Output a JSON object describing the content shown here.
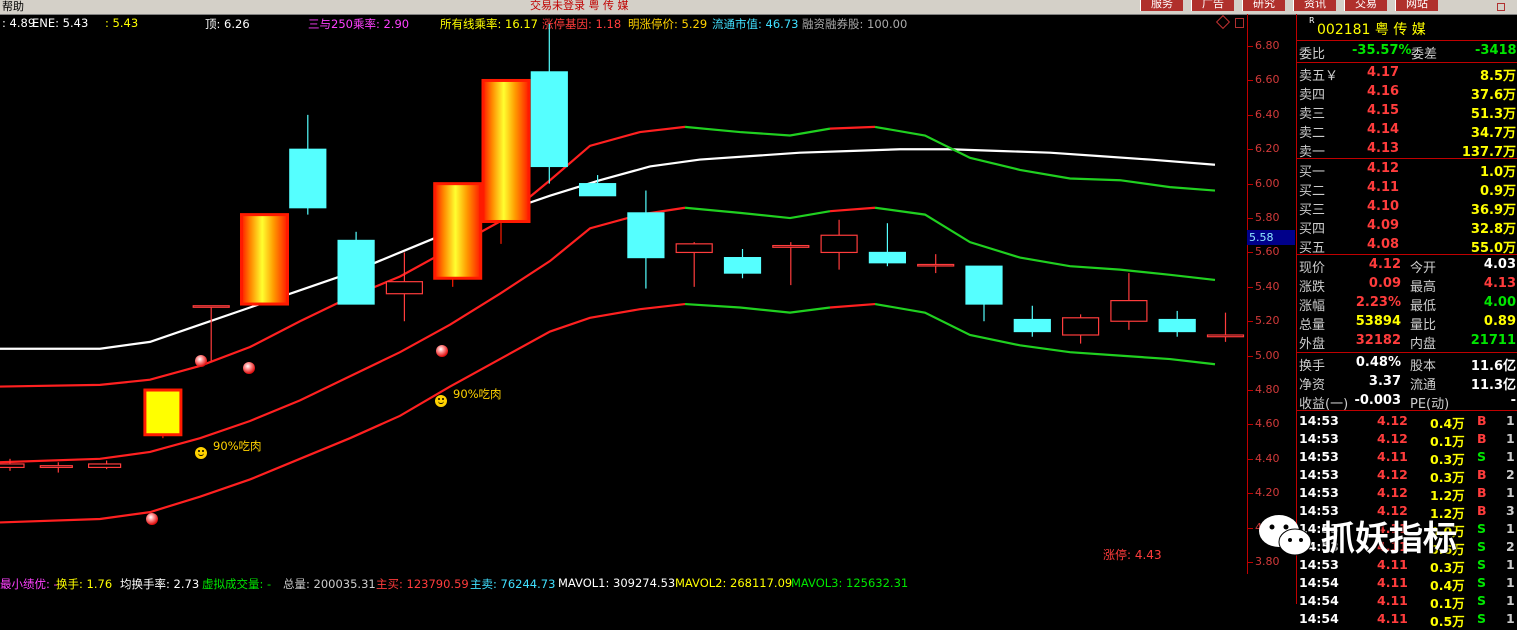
{
  "topbar": {
    "menu": "帮助",
    "window_title": "交易未登录  粤 传 媒",
    "buttons": [
      "服务",
      "广告",
      "研究",
      "资讯",
      "交易",
      "网站"
    ]
  },
  "indicator_line": [
    {
      "text": ": 4.89",
      "color": "#ffffff"
    },
    {
      "text": "ENE: 5.43",
      "color": "#ffffff"
    },
    {
      "text": ": 5.43",
      "color": "#ffff00"
    },
    {
      "text": "顶: 6.26",
      "color": "#ffffff"
    },
    {
      "text": "三与250乘率: 2.90",
      "color": "#ff40ff"
    },
    {
      "text": "所有线乘率: 16.17",
      "color": "#ffff00"
    },
    {
      "text": "涨停基因: 1.18",
      "color": "#ff3c3c"
    },
    {
      "text": "明涨停价: 5.29",
      "color": "#ffd200"
    },
    {
      "text": "流通市值: 46.73",
      "color": "#40e0ff"
    },
    {
      "text": "融资融券股: 100.00",
      "color": "#aaaaaa"
    }
  ],
  "chart_data": {
    "type": "candlestick",
    "ylim": [
      3.8,
      6.94
    ],
    "yticks": [
      "6.80",
      "6.60",
      "6.40",
      "6.20",
      "6.00",
      "5.80",
      "5.60",
      "5.40",
      "5.20",
      "5.00",
      "4.80",
      "4.60",
      "4.40",
      "4.20",
      "4.00",
      "3.80"
    ],
    "current_price_label": "5.58",
    "limit_up_label": "涨停: 4.43",
    "candles": [
      {
        "o": 4.37,
        "c": 4.35,
        "h": 4.4,
        "l": 4.33
      },
      {
        "o": 4.36,
        "c": 4.35,
        "h": 4.38,
        "l": 4.32
      },
      {
        "o": 4.37,
        "c": 4.35,
        "h": 4.39,
        "l": 4.34
      },
      {
        "o": 4.54,
        "c": 4.8,
        "h": 4.8,
        "l": 4.52,
        "style": "limit"
      },
      {
        "o": 5.29,
        "c": 5.29,
        "h": 5.29,
        "l": 4.97,
        "style": "doji"
      },
      {
        "o": 5.3,
        "c": 5.82,
        "h": 5.82,
        "l": 5.3,
        "style": "limit"
      },
      {
        "o": 5.86,
        "c": 6.2,
        "h": 6.4,
        "l": 5.82,
        "style": "down"
      },
      {
        "o": 5.67,
        "c": 5.3,
        "h": 5.72,
        "l": 5.3,
        "style": "down"
      },
      {
        "o": 5.36,
        "c": 5.43,
        "h": 5.6,
        "l": 5.2,
        "style": "up"
      },
      {
        "o": 5.45,
        "c": 6.0,
        "h": 6.0,
        "l": 5.4,
        "style": "limit"
      },
      {
        "o": 5.78,
        "c": 6.6,
        "h": 6.6,
        "l": 5.65,
        "style": "limit"
      },
      {
        "o": 6.65,
        "c": 6.1,
        "h": 6.93,
        "l": 6.0,
        "style": "down"
      },
      {
        "o": 6.0,
        "c": 5.93,
        "h": 6.05,
        "l": 5.93,
        "style": "down"
      },
      {
        "o": 5.83,
        "c": 5.57,
        "h": 5.96,
        "l": 5.39,
        "style": "down"
      },
      {
        "o": 5.65,
        "c": 5.6,
        "h": 5.66,
        "l": 5.4,
        "style": "up"
      },
      {
        "o": 5.57,
        "c": 5.48,
        "h": 5.62,
        "l": 5.45,
        "style": "down"
      },
      {
        "o": 5.64,
        "c": 5.63,
        "h": 5.66,
        "l": 5.41,
        "style": "up"
      },
      {
        "o": 5.6,
        "c": 5.7,
        "h": 5.79,
        "l": 5.5,
        "style": "up"
      },
      {
        "o": 5.6,
        "c": 5.54,
        "h": 5.77,
        "l": 5.52,
        "style": "down"
      },
      {
        "o": 5.53,
        "c": 5.53,
        "h": 5.59,
        "l": 5.48,
        "style": "up"
      },
      {
        "o": 5.52,
        "c": 5.3,
        "h": 5.52,
        "l": 5.2,
        "style": "down"
      },
      {
        "o": 5.21,
        "c": 5.14,
        "h": 5.29,
        "l": 5.11,
        "style": "down"
      },
      {
        "o": 5.12,
        "c": 5.22,
        "h": 5.24,
        "l": 5.07,
        "style": "up"
      },
      {
        "o": 5.2,
        "c": 5.32,
        "h": 5.48,
        "l": 5.15,
        "style": "up"
      },
      {
        "o": 5.21,
        "c": 5.14,
        "h": 5.26,
        "l": 5.11,
        "style": "down"
      },
      {
        "o": 5.11,
        "c": 5.12,
        "h": 5.25,
        "l": 5.08,
        "style": "up"
      }
    ]
  },
  "annotations": {
    "label_90": "90%吃肉"
  },
  "quote": {
    "r_badge": "R",
    "code": "002181",
    "name": "粤 传 媒",
    "wei_bi": {
      "label": "委比",
      "value": "-35.57%",
      "label2": "委差",
      "value2": "-3418"
    },
    "asks": [
      {
        "label": "卖五￥",
        "price": "4.17",
        "vol": "8.5万"
      },
      {
        "label": "卖四",
        "price": "4.16",
        "vol": "37.6万"
      },
      {
        "label": "卖三",
        "price": "4.15",
        "vol": "51.3万"
      },
      {
        "label": "卖二",
        "price": "4.14",
        "vol": "34.7万"
      },
      {
        "label": "卖一",
        "price": "4.13",
        "vol": "137.7万"
      }
    ],
    "bids": [
      {
        "label": "买一",
        "price": "4.12",
        "vol": "1.0万"
      },
      {
        "label": "买二",
        "price": "4.11",
        "vol": "0.9万"
      },
      {
        "label": "买三",
        "price": "4.10",
        "vol": "36.9万"
      },
      {
        "label": "买四",
        "price": "4.09",
        "vol": "32.8万"
      },
      {
        "label": "买五",
        "price": "4.08",
        "vol": "55.0万"
      }
    ],
    "stats": [
      {
        "l1": "现价",
        "v1": "4.12",
        "c1": "#ff3c3c",
        "l2": "今开",
        "v2": "4.03",
        "c2": "#ffffff"
      },
      {
        "l1": "涨跌",
        "v1": "0.09",
        "c1": "#ff3c3c",
        "l2": "最高",
        "v2": "4.13",
        "c2": "#ff3c3c"
      },
      {
        "l1": "涨幅",
        "v1": "2.23%",
        "c1": "#ff3c3c",
        "l2": "最低",
        "v2": "4.00",
        "c2": "#00e600"
      },
      {
        "l1": "总量",
        "v1": "53894",
        "c1": "#ffff00",
        "l2": "量比",
        "v2": "0.89",
        "c2": "#ffff00"
      },
      {
        "l1": "外盘",
        "v1": "32182",
        "c1": "#ff3c3c",
        "l2": "内盘",
        "v2": "21711",
        "c2": "#00e600"
      }
    ],
    "stats2": [
      {
        "l1": "换手",
        "v1": "0.48%",
        "l2": "股本",
        "v2": "11.6亿"
      },
      {
        "l1": "净资",
        "v1": "3.37",
        "l2": "流通",
        "v2": "11.3亿"
      },
      {
        "l1": "收益(一)",
        "v1": "-0.003",
        "l2": "PE(动)",
        "v2": "-"
      }
    ],
    "ticks": [
      {
        "t": "14:53",
        "p": "4.12",
        "pc": "#ff3c3c",
        "v": "0.4万",
        "s": "B",
        "n": "1"
      },
      {
        "t": "14:53",
        "p": "4.12",
        "pc": "#ff3c3c",
        "v": "0.1万",
        "s": "B",
        "n": "1"
      },
      {
        "t": "14:53",
        "p": "4.11",
        "pc": "#ff3c3c",
        "v": "0.3万",
        "s": "S",
        "n": "1"
      },
      {
        "t": "14:53",
        "p": "4.12",
        "pc": "#ff3c3c",
        "v": "0.3万",
        "s": "B",
        "n": "2"
      },
      {
        "t": "14:53",
        "p": "4.12",
        "pc": "#ff3c3c",
        "v": "1.2万",
        "s": "B",
        "n": "1"
      },
      {
        "t": "14:53",
        "p": "4.12",
        "pc": "#ff3c3c",
        "v": "1.2万",
        "s": "B",
        "n": "3"
      },
      {
        "t": "14:53",
        "p": "4.11",
        "pc": "#ff3c3c",
        "v": "0.0万",
        "s": "S",
        "n": "1"
      },
      {
        "t": "14:53",
        "p": "4.11",
        "pc": "#ff3c3c",
        "v": "0.6万",
        "s": "S",
        "n": "2"
      },
      {
        "t": "14:53",
        "p": "4.11",
        "pc": "#ff3c3c",
        "v": "0.3万",
        "s": "S",
        "n": "1"
      },
      {
        "t": "14:54",
        "p": "4.11",
        "pc": "#ff3c3c",
        "v": "0.4万",
        "s": "S",
        "n": "1"
      },
      {
        "t": "14:54",
        "p": "4.11",
        "pc": "#ff3c3c",
        "v": "0.1万",
        "s": "S",
        "n": "1"
      },
      {
        "t": "14:54",
        "p": "4.11",
        "pc": "#ff3c3c",
        "v": "0.5万",
        "s": "S",
        "n": "1"
      }
    ]
  },
  "bottom_line": [
    {
      "text": "最小绩优: -",
      "color": "#ff40ff"
    },
    {
      "text": "换手: 1.76",
      "color": "#ffff00"
    },
    {
      "text": "均换手率: 2.73",
      "color": "#ffffff"
    },
    {
      "text": "虚拟成交量: -",
      "color": "#00e600"
    },
    {
      "text": "总量: 200035.31",
      "color": "#cccccc"
    },
    {
      "text": "主买: 123790.59",
      "color": "#ff3c3c"
    },
    {
      "text": "主卖: 76244.73",
      "color": "#40e0ff"
    },
    {
      "text": "MAVOL1: 309274.53",
      "color": "#ffffff"
    },
    {
      "text": "MAVOL2: 268117.09",
      "color": "#ffff00"
    },
    {
      "text": "MAVOL3: 125632.31",
      "color": "#00e600"
    }
  ],
  "watermark": {
    "text": "抓妖指标",
    "icon": "wechat-icon"
  }
}
